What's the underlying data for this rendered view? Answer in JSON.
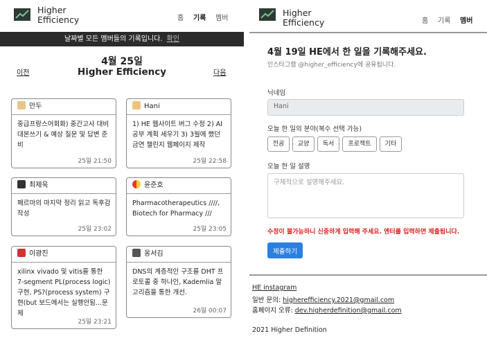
{
  "left": {
    "brand": "Higher Efficiency",
    "nav": {
      "home": "홈",
      "record": "기록",
      "members": "멤버"
    },
    "banner": {
      "text": "날짜별 모든 멤버들의 기록입니다.",
      "confirm": "확인"
    },
    "date_title": "4월 25일",
    "subtitle": "Higher Efficiency",
    "prev": "이전",
    "next": "다음",
    "cards": [
      {
        "name": "만두",
        "icon": "dumpling-icon",
        "text": "중급프랑스어회화) 중간고사 대비 대본쓰기 & 예상 질문 및 답변 준비",
        "time": "25일 21:50"
      },
      {
        "name": "Hani",
        "icon": "runner-icon",
        "text": "1) HE 웹사이트 버그 수정 2) AI 공부 계획 세우기 3) 3월에 했던 금연 챌린지 웹페이지 제작",
        "time": "25일 22:58"
      },
      {
        "name": "최제욱",
        "icon": "laptop-icon",
        "text": "페르마의 마지막 정리 읽고 독후감 작성",
        "time": "25일 23:02"
      },
      {
        "name": "윤준호",
        "icon": "pill-icon",
        "text": "Pharmacotherapeutics ////, Biotech for Pharmacy ///",
        "time": "25일 23:05"
      },
      {
        "name": "이광진",
        "icon": "person-icon",
        "text": "xilinx vivado 및 vitis를 통한 7-segment PL(process logic) 구현, PS?(process system) 구현(but 보드에서는 실행안됨...문제",
        "time": "25일 23:21"
      },
      {
        "name": "옹서김",
        "icon": "floppy-icon",
        "text": "DNS의 계층적인 구조를 DHT 프로토콜 중 하나인, Kademlia 알고리즘을 통한 개선.",
        "time": "26일 00:07"
      }
    ]
  },
  "right": {
    "brand": "Higher Efficiency",
    "nav": {
      "home": "홈",
      "record": "기록",
      "members": "멤버"
    },
    "heading": "4월 19일 HE에서 한 일을 기록해주세요.",
    "subtext": "인스타그램 @higher_efficiency에 공유됩니다.",
    "nickname_label": "닉네임",
    "nickname_value": "Hani",
    "field_label": "오늘 한 일의 분야(복수 선택 가능)",
    "chips": [
      "전공",
      "교양",
      "독서",
      "프로젝트",
      "기타"
    ],
    "desc_label": "오늘 한 일 설명",
    "desc_placeholder": "구체적으로 설명해주세요.",
    "warning": "수정이 불가능하니 신중하게 입력해 주세요. 엔터를 입력하면 제출됩니다.",
    "submit": "제출하기",
    "footer": {
      "instagram": "HE instagram",
      "general_label": "일반 문의:",
      "general_email": "higherefficiency.2021@gmail.com",
      "bug_label": "홈페이지 오류:",
      "bug_email": "dev.higherdefinition@gmail.com",
      "copyright": "2021 Higher Definition"
    }
  },
  "colors": {
    "banner_bg": "#2b2b2b",
    "submit_bg": "#2b7fe0",
    "warning": "#dd2222",
    "logo_green": "#3b6b4f"
  }
}
